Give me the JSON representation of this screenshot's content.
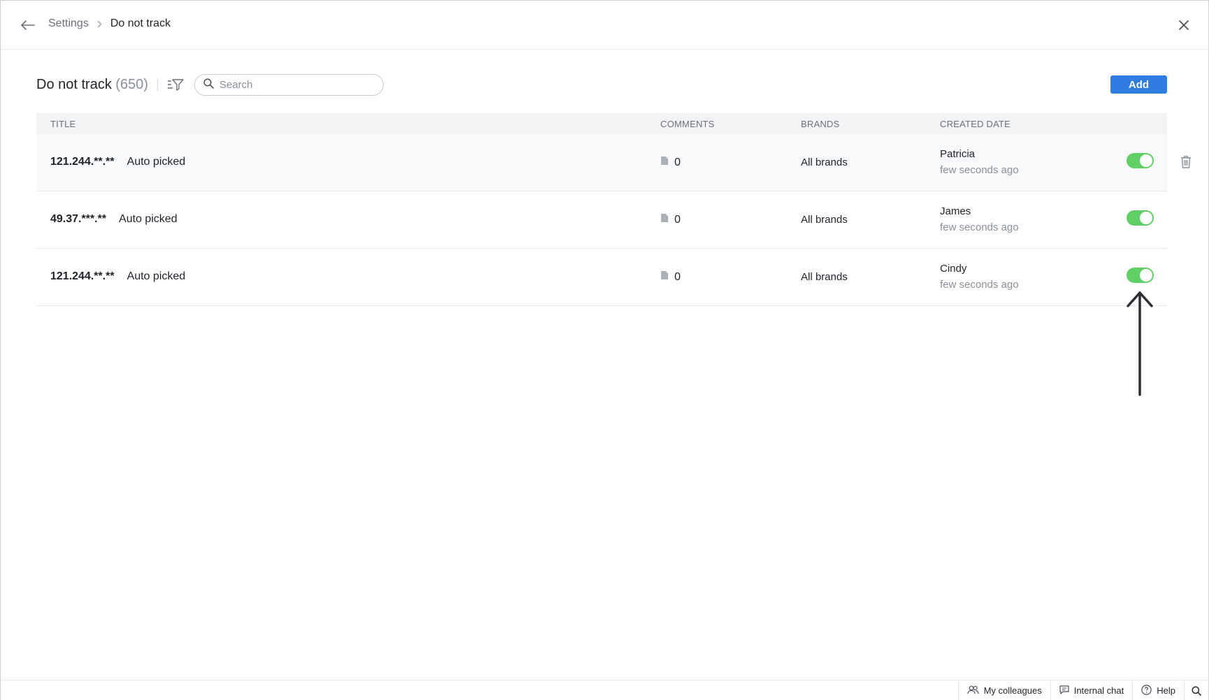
{
  "header": {
    "breadcrumb_parent": "Settings",
    "breadcrumb_current": "Do not track"
  },
  "toolbar": {
    "title": "Do not track",
    "count": "(650)",
    "search_placeholder": "Search",
    "add_label": "Add"
  },
  "table": {
    "columns": [
      "TITLE",
      "COMMENTS",
      "BRANDS",
      "CREATED DATE"
    ],
    "rows": [
      {
        "ip": "121.244.**.**",
        "tag": "Auto picked",
        "comments": "0",
        "brands": "All brands",
        "creator": "Patricia",
        "when": "few seconds ago",
        "enabled": true
      },
      {
        "ip": "49.37.***.**",
        "tag": "Auto picked",
        "comments": "0",
        "brands": "All brands",
        "creator": "James",
        "when": "few seconds ago",
        "enabled": true
      },
      {
        "ip": "121.244.**.**",
        "tag": "Auto picked",
        "comments": "0",
        "brands": "All brands",
        "creator": "Cindy",
        "when": "few seconds ago",
        "enabled": true
      }
    ]
  },
  "footer": {
    "colleagues": "My colleagues",
    "chat": "Internal chat",
    "help": "Help"
  },
  "colors": {
    "accent": "#2f7de1",
    "toggle_on": "#5fcf66"
  },
  "icons": [
    "back-arrow-icon",
    "chevron-right-icon",
    "close-icon",
    "filter-icon",
    "search-icon",
    "document-icon",
    "trash-icon",
    "colleagues-icon",
    "chat-icon",
    "help-icon",
    "search-icon"
  ]
}
